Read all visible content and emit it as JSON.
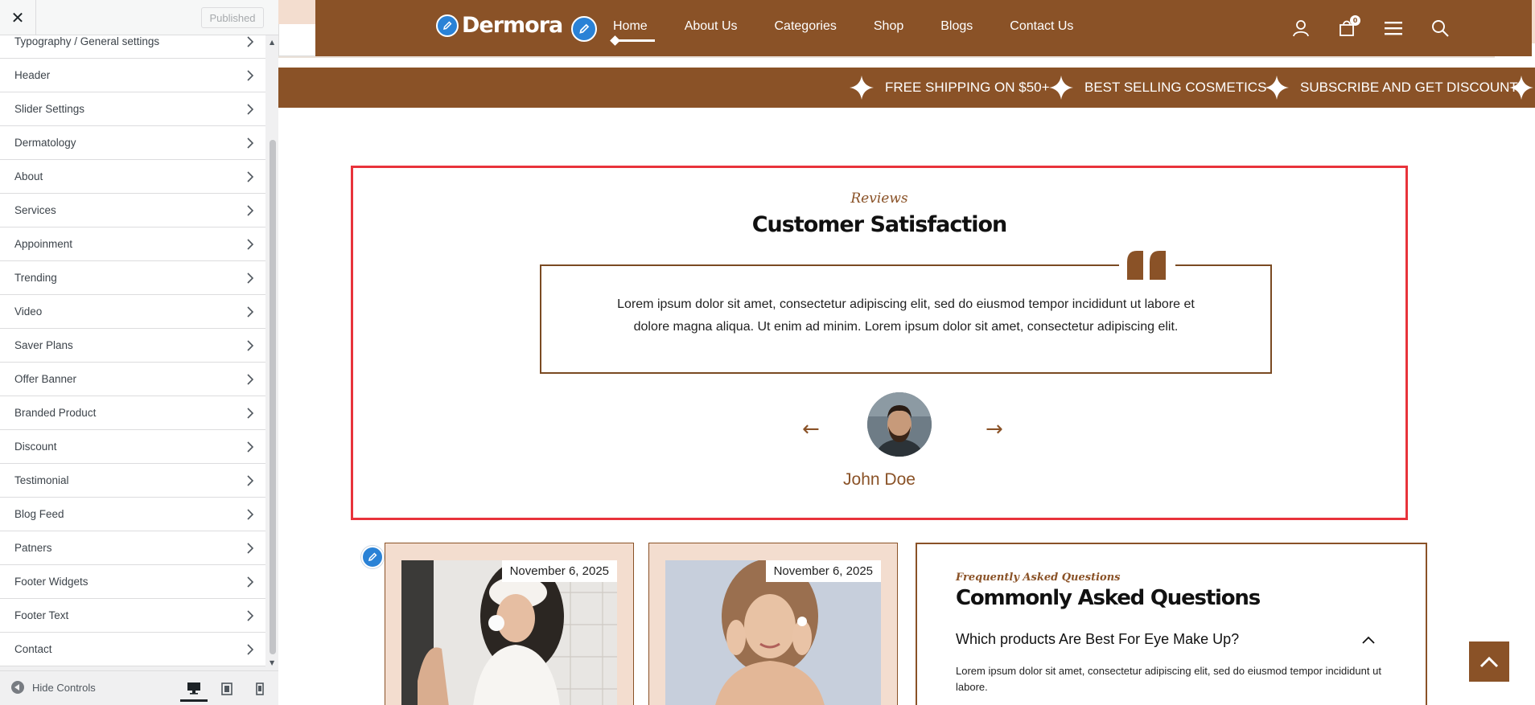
{
  "sidebar": {
    "close_label": "✕",
    "publish_label": "Published",
    "hide_controls_label": "Hide Controls",
    "items": [
      {
        "label": "Typography / General settings"
      },
      {
        "label": "Header"
      },
      {
        "label": "Slider Settings"
      },
      {
        "label": "Dermatology"
      },
      {
        "label": "About"
      },
      {
        "label": "Services"
      },
      {
        "label": "Appoinment"
      },
      {
        "label": "Trending"
      },
      {
        "label": "Video"
      },
      {
        "label": "Saver Plans"
      },
      {
        "label": "Offer Banner"
      },
      {
        "label": "Branded Product"
      },
      {
        "label": "Discount"
      },
      {
        "label": "Testimonial"
      },
      {
        "label": "Blog Feed"
      },
      {
        "label": "Patners"
      },
      {
        "label": "Footer Widgets"
      },
      {
        "label": "Footer Text"
      },
      {
        "label": "Contact"
      }
    ],
    "highlighted_item": "Testimonial",
    "devices": [
      "desktop-icon",
      "tablet-icon",
      "mobile-icon"
    ],
    "active_device": "desktop"
  },
  "header": {
    "logo_text": "Dermora",
    "nav": [
      "Home",
      "About Us",
      "Categories",
      "Shop",
      "Blogs",
      "Contact Us"
    ],
    "active_nav": "Home",
    "cart_count": "0",
    "icons": [
      "user-icon",
      "cart-icon",
      "menu-icon",
      "search-icon"
    ]
  },
  "marquee": [
    "FREE SHIPPING ON $50+",
    "BEST SELLING COSMETICS",
    "SUBSCRIBE AND GET DISCOUNT"
  ],
  "testimonial": {
    "kicker": "Reviews",
    "title": "Customer Satisfaction",
    "text": "Lorem ipsum dolor sit amet, consectetur adipiscing elit, sed do eiusmod tempor incididunt ut labore et dolore magna aliqua. Ut enim ad minim. Lorem ipsum dolor sit amet, consectetur adipiscing elit.",
    "prev": "←",
    "next": "→",
    "name": "John Doe"
  },
  "blog": [
    {
      "date": "November 6, 2025"
    },
    {
      "date": "November 6, 2025"
    }
  ],
  "faq": {
    "kicker": "Frequently Asked Questions",
    "title": "Commonly Asked Questions",
    "question": "Which products Are Best For Eye Make Up?",
    "answer": "Lorem ipsum dolor sit amet, consectetur adipiscing elit, sed do eiusmod tempor incididunt ut labore."
  },
  "colors": {
    "brand": "#8a5227",
    "peach": "#f3ddcf",
    "highlight": "#e8333b",
    "edit_pen": "#2a82d6"
  }
}
